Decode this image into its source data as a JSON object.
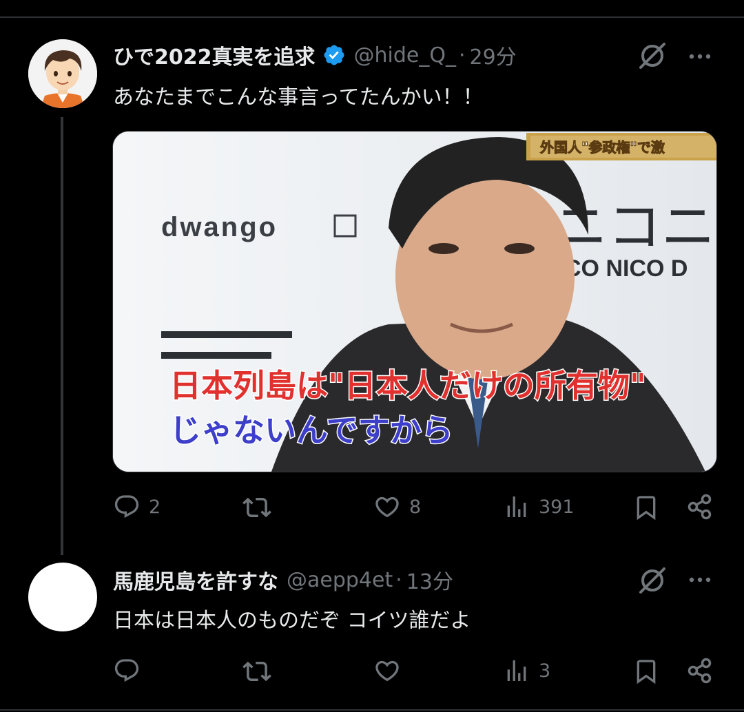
{
  "tweets": [
    {
      "display_name": "ひで2022真実を追求",
      "verified": true,
      "handle": "@hide_Q_",
      "time": "29分",
      "text": "あなたまでこんな事言ってたんかい！！",
      "media": {
        "top_banner": "外国人\"参政権\"で激",
        "logo_left": "dwango",
        "logo_right": "ニコニコ動",
        "logo_right_sub": "CO NICO D",
        "caption_line1": "日本列島は\"日本人だけの所有物\"",
        "caption_line2": "じゃないんですから"
      },
      "stats": {
        "replies": "2",
        "retweets": "",
        "likes": "8",
        "views": "391"
      }
    },
    {
      "display_name": "馬鹿児島を許すな",
      "verified": false,
      "handle": "@aepp4et",
      "time": "13分",
      "text": "日本は日本人のものだぞ コイツ誰だよ",
      "stats": {
        "replies": "",
        "retweets": "",
        "likes": "",
        "views": "3"
      }
    }
  ],
  "colors": {
    "background": "#000000",
    "text_primary": "#e7e9ea",
    "text_secondary": "#71767b",
    "verified_blue": "#1d9bf0",
    "divider": "#2f3336"
  },
  "icons": [
    "verified-badge-icon",
    "grok-icon",
    "more-icon",
    "reply-icon",
    "retweet-icon",
    "like-icon",
    "views-icon",
    "bookmark-icon",
    "share-icon"
  ]
}
